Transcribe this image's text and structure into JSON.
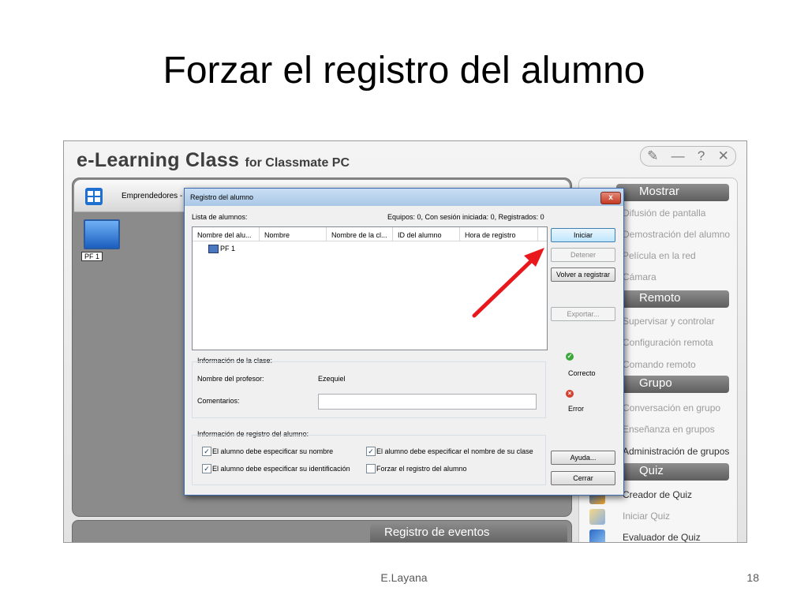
{
  "slide": {
    "title": "Forzar el registro del alumno",
    "author": "E.Layana",
    "page_number": "18"
  },
  "app": {
    "title_main": "e-Learning Class",
    "title_sub": "for Classmate PC",
    "window_controls": {
      "tools": "✎",
      "minimize": "—",
      "help": "?",
      "close": "✕"
    },
    "group_name": "Emprendedores - 01",
    "student_label": "PF 1",
    "log_header": "Registro de eventos",
    "right_panel": {
      "sections": [
        {
          "header": "Mostrar",
          "items": [
            {
              "label": "Difusión de pantalla",
              "active": false
            },
            {
              "label": "Demostración del alumno",
              "active": false
            },
            {
              "label": "Película en la red",
              "active": false
            },
            {
              "label": "Cámara",
              "active": false
            }
          ]
        },
        {
          "header": "Remoto",
          "items": [
            {
              "label": "Supervisar y controlar",
              "active": false
            },
            {
              "label": "Configuración remota",
              "active": false
            },
            {
              "label": "Comando remoto",
              "active": false
            }
          ]
        },
        {
          "header": "Grupo",
          "items": [
            {
              "label": "Conversación en grupo",
              "active": false
            },
            {
              "label": "Enseñanza en grupos",
              "active": false
            },
            {
              "label": "Administración de grupos",
              "active": true
            }
          ]
        },
        {
          "header": "Quiz",
          "items": [
            {
              "label": "Creador de Quiz",
              "active": true
            },
            {
              "label": "Iniciar Quiz",
              "active": false
            },
            {
              "label": "Evaluador de Quiz",
              "active": true
            }
          ]
        }
      ]
    }
  },
  "dialog": {
    "title": "Registro del alumno",
    "close_label": "x",
    "list_label": "Lista de alumnos:",
    "stats": "Equipos: 0, Con sesión iniciada: 0, Registrados: 0",
    "columns": [
      "Nombre del alu...",
      "Nombre",
      "Nombre de la cl...",
      "ID del alumno",
      "Hora de registro"
    ],
    "rows": [
      {
        "name": "PF 1"
      }
    ],
    "buttons": {
      "start": "Iniciar",
      "stop": "Detener",
      "re_register": "Volver a registrar",
      "export": "Exportar...",
      "help": "Ayuda...",
      "close": "Cerrar"
    },
    "status": {
      "ok": "Correcto",
      "error": "Error"
    },
    "class_info": {
      "heading": "Información de la clase:",
      "teacher_label": "Nombre del profesor:",
      "teacher_value": "Ezequiel",
      "comments_label": "Comentarios:",
      "comments_value": ""
    },
    "registration": {
      "heading": "Información de registro del alumno:",
      "options": [
        {
          "label": "El alumno debe especificar su nombre",
          "checked": true
        },
        {
          "label": "El alumno debe especificar el nombre de su clase",
          "checked": true
        },
        {
          "label": "El alumno debe especificar su identificación",
          "checked": true
        },
        {
          "label": "Forzar el registro del alumno",
          "checked": false
        }
      ]
    }
  },
  "colors": {
    "arrow": "#e8181c",
    "accent": "#3c7fb1"
  }
}
